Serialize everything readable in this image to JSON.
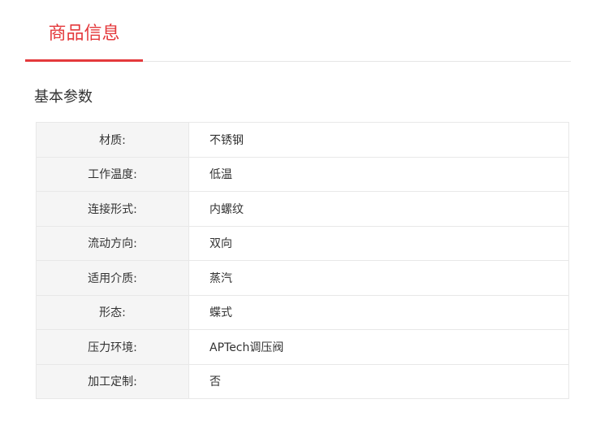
{
  "tab": {
    "title": "商品信息"
  },
  "section": {
    "title": "基本参数"
  },
  "params": [
    {
      "label": "材质:",
      "value": "不锈钢"
    },
    {
      "label": "工作温度:",
      "value": "低温"
    },
    {
      "label": "连接形式:",
      "value": "内螺纹"
    },
    {
      "label": "流动方向:",
      "value": "双向"
    },
    {
      "label": "适用介质:",
      "value": "蒸汽"
    },
    {
      "label": "形态:",
      "value": "蝶式"
    },
    {
      "label": "压力环境:",
      "value": "APTech调压阀"
    },
    {
      "label": "加工定制:",
      "value": "否"
    }
  ],
  "colors": {
    "accent": "#e4393c",
    "label_bg": "#f5f5f5",
    "border": "#e8e8e8",
    "text": "#333333"
  }
}
